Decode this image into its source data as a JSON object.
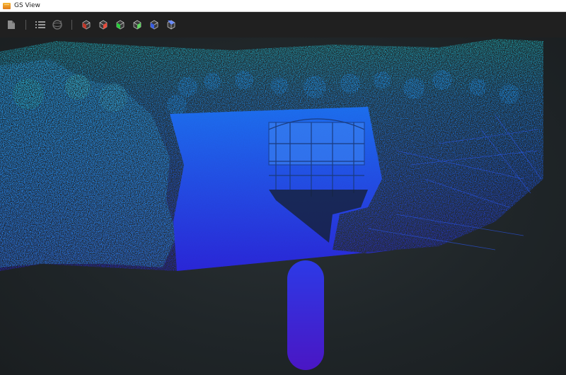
{
  "window": {
    "title": "GS View",
    "app_icon": "app-logo-icon"
  },
  "toolbar": {
    "groups": [
      {
        "items": [
          {
            "name": "file-icon",
            "color": "#9a9a9a"
          }
        ]
      },
      {
        "items": [
          {
            "name": "list-icon",
            "color": "#9a9a9a"
          },
          {
            "name": "rotate-3d-icon",
            "color": "#6a6a6a"
          }
        ]
      },
      {
        "items": [
          {
            "name": "view-cube-default-icon",
            "color": "#c0392b"
          },
          {
            "name": "view-cube-red-icon",
            "color": "#e74c3c"
          },
          {
            "name": "view-cube-green-icon",
            "color": "#2ecc40"
          },
          {
            "name": "view-cube-green-alt-icon",
            "color": "#5fd35f"
          },
          {
            "name": "view-cube-blue-icon",
            "color": "#3a5fe0"
          },
          {
            "name": "view-cube-blue-alt-icon",
            "color": "#6b8cff"
          }
        ]
      }
    ]
  },
  "viewport": {
    "content": "point-cloud-render",
    "palette": {
      "top": "#1fb7c9",
      "mid": "#1d6cf0",
      "bottom": "#2a1fd6",
      "trajectory": "#3d1fd0"
    }
  }
}
